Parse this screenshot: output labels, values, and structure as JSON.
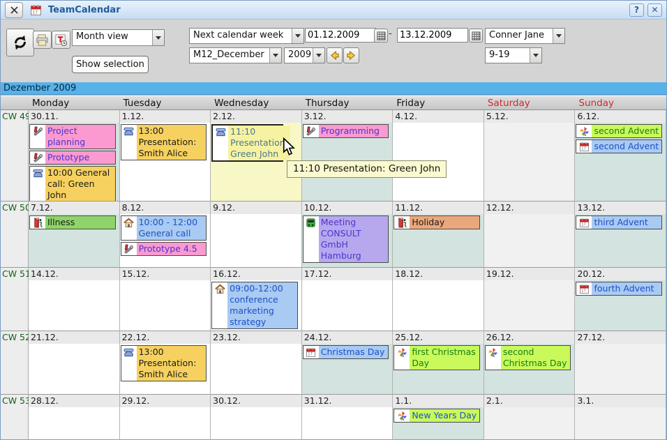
{
  "window": {
    "title": "TeamCalendar",
    "help_label": "?",
    "close_label": "✕"
  },
  "toolbar": {
    "view_select": "Month view",
    "show_selection_label": "Show selection",
    "range_select": "Next calendar week",
    "date_from": "01.12.2009",
    "range_separator": "-",
    "date_to": "13.12.2009",
    "person_select": "Conner Jane",
    "month_select": "M12_December",
    "year_select": "2009",
    "hours_select": "9-19"
  },
  "palette": {
    "pink": "#fa9ad0",
    "gold": "#f6d15f",
    "paleyellow": "#f6f2a2",
    "green": "#8fd46a",
    "yellowgreen": "#c9f95a",
    "blue": "#a9caf2",
    "purple": "#b7a8ee",
    "orange": "#eaa77d"
  },
  "text_colors": {
    "violet": "#4a35cf",
    "blue": "#1d50c8",
    "green": "#158015",
    "black": "#1a1a1a",
    "slate": "#4b7991"
  },
  "tooltip": {
    "text": "11:10 Presentation: Green John"
  },
  "calendar": {
    "month_title": "Dezember 2009",
    "day_headers": [
      {
        "label": "Monday",
        "weekend": false
      },
      {
        "label": "Tuesday",
        "weekend": false
      },
      {
        "label": "Wednesday",
        "weekend": false
      },
      {
        "label": "Thursday",
        "weekend": false
      },
      {
        "label": "Friday",
        "weekend": false
      },
      {
        "label": "Saturday",
        "weekend": true
      },
      {
        "label": "Sunday",
        "weekend": true
      }
    ],
    "weeks": [
      {
        "cw": "CW 49",
        "days": [
          {
            "date": "30.11.",
            "bg": "teal",
            "events": [
              {
                "icon": "tools-icon",
                "color": "pink",
                "text": "Project planning",
                "text_color": "violet"
              },
              {
                "icon": "tools-icon",
                "color": "pink",
                "text": "Prototype",
                "text_color": "violet"
              },
              {
                "icon": "phone-icon",
                "color": "gold",
                "text": "10:00 General call: Green John",
                "text_color": "black"
              }
            ]
          },
          {
            "date": "1.12.",
            "bg": "white",
            "events": [
              {
                "icon": "phone-icon",
                "color": "gold",
                "text": "13:00 Presentation: Smith Alice",
                "text_color": "black"
              }
            ]
          },
          {
            "date": "2.12.",
            "bg": "paleyellow",
            "events": [
              {
                "icon": "phone-icon",
                "color": "paleyellow",
                "text": "11:10 Presentation: Green John",
                "text_color": "slate",
                "selected": true
              }
            ]
          },
          {
            "date": "3.12.",
            "bg": "teal",
            "events": [
              {
                "icon": "tools-icon",
                "color": "pink",
                "text": "Programming",
                "text_color": "violet"
              }
            ]
          },
          {
            "date": "4.12.",
            "bg": "white",
            "events": []
          },
          {
            "date": "5.12.",
            "bg": "lightgray",
            "events": []
          },
          {
            "date": "6.12.",
            "bg": "teal",
            "events": [
              {
                "icon": "party-icon",
                "color": "yellowgreen",
                "text": "second Advent",
                "text_color": "green"
              },
              {
                "icon": "calendar-icon",
                "color": "blue",
                "text": "second Advent",
                "text_color": "blue"
              }
            ]
          }
        ]
      },
      {
        "cw": "CW 50",
        "days": [
          {
            "date": "7.12.",
            "bg": "teal",
            "events": [
              {
                "icon": "absence-icon",
                "color": "green",
                "text": "Illness",
                "text_color": "black"
              }
            ]
          },
          {
            "date": "8.12.",
            "bg": "white",
            "events": [
              {
                "icon": "home-icon",
                "color": "blue",
                "text": "10:00 - 12:00 General call",
                "text_color": "blue"
              },
              {
                "icon": "tools-icon",
                "color": "pink",
                "text": "Prototype 4.5",
                "text_color": "violet"
              }
            ]
          },
          {
            "date": "9.12.",
            "bg": "white",
            "events": []
          },
          {
            "date": "10.12.",
            "bg": "teal",
            "events": [
              {
                "icon": "bus-icon",
                "color": "purple",
                "text": "Meeting CONSULT GmbH Hamburg",
                "text_color": "violet"
              }
            ]
          },
          {
            "date": "11.12.",
            "bg": "teal",
            "events": [
              {
                "icon": "absence-icon",
                "color": "orange",
                "text": "Holiday",
                "text_color": "black"
              }
            ]
          },
          {
            "date": "12.12.",
            "bg": "lightgray",
            "events": []
          },
          {
            "date": "13.12.",
            "bg": "teal",
            "events": [
              {
                "icon": "calendar-icon",
                "color": "blue",
                "text": "third Advent",
                "text_color": "blue"
              }
            ]
          }
        ]
      },
      {
        "cw": "CW 51",
        "days": [
          {
            "date": "14.12.",
            "bg": "white",
            "events": []
          },
          {
            "date": "15.12.",
            "bg": "white",
            "events": []
          },
          {
            "date": "16.12.",
            "bg": "white",
            "events": [
              {
                "icon": "home-icon",
                "color": "blue",
                "text": "09:00-12:00 conference marketing strategy",
                "text_color": "blue"
              }
            ]
          },
          {
            "date": "17.12.",
            "bg": "white",
            "events": []
          },
          {
            "date": "18.12.",
            "bg": "white",
            "events": []
          },
          {
            "date": "19.12.",
            "bg": "lightgray",
            "events": []
          },
          {
            "date": "20.12.",
            "bg": "teal",
            "events": [
              {
                "icon": "calendar-icon",
                "color": "blue",
                "text": "fourth Advent",
                "text_color": "blue"
              }
            ]
          }
        ]
      },
      {
        "cw": "CW 52",
        "days": [
          {
            "date": "21.12.",
            "bg": "white",
            "events": []
          },
          {
            "date": "22.12.",
            "bg": "white",
            "events": [
              {
                "icon": "phone-icon",
                "color": "gold",
                "text": "13:00 Presentation: Smith Alice",
                "text_color": "black"
              }
            ]
          },
          {
            "date": "23.12.",
            "bg": "white",
            "events": []
          },
          {
            "date": "24.12.",
            "bg": "teal",
            "events": [
              {
                "icon": "calendar-icon",
                "color": "blue",
                "text": "Christmas Day",
                "text_color": "blue"
              }
            ]
          },
          {
            "date": "25.12.",
            "bg": "teal",
            "events": [
              {
                "icon": "party-icon",
                "color": "yellowgreen",
                "text": "first Christmas Day",
                "text_color": "green"
              }
            ]
          },
          {
            "date": "26.12.",
            "bg": "teal",
            "events": [
              {
                "icon": "party-icon",
                "color": "yellowgreen",
                "text": "second Christmas Day",
                "text_color": "green"
              }
            ]
          },
          {
            "date": "27.12.",
            "bg": "lightgray",
            "events": []
          }
        ]
      },
      {
        "cw": "CW 53",
        "days": [
          {
            "date": "28.12.",
            "bg": "white",
            "events": []
          },
          {
            "date": "29.12.",
            "bg": "white",
            "events": []
          },
          {
            "date": "30.12.",
            "bg": "white",
            "events": []
          },
          {
            "date": "31.12.",
            "bg": "white",
            "events": []
          },
          {
            "date": "1.1.",
            "bg": "teal",
            "events": [
              {
                "icon": "party-icon",
                "color": "yellowgreen",
                "text": "New Years Day",
                "text_color": "blue"
              }
            ]
          },
          {
            "date": "2.1.",
            "bg": "lightgray",
            "events": []
          },
          {
            "date": "3.1.",
            "bg": "lightgray",
            "events": []
          }
        ]
      }
    ]
  }
}
